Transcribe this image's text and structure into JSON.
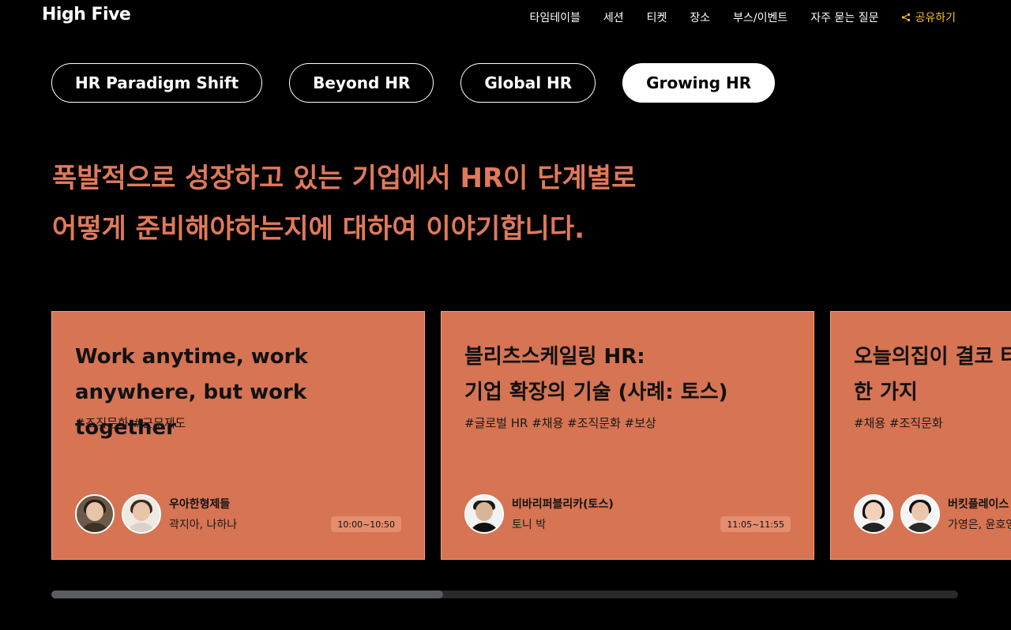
{
  "header": {
    "logo": "High Five",
    "nav": [
      {
        "label": "타임테이블"
      },
      {
        "label": "세션"
      },
      {
        "label": "티켓"
      },
      {
        "label": "장소"
      },
      {
        "label": "부스/이벤트"
      },
      {
        "label": "자주 묻는 질문"
      }
    ],
    "share_label": "공유하기",
    "share_icon": "share-icon"
  },
  "tabs": [
    {
      "label": "HR Paradigm Shift",
      "active": false
    },
    {
      "label": "Beyond HR",
      "active": false
    },
    {
      "label": "Global HR",
      "active": false
    },
    {
      "label": "Growing HR",
      "active": true
    }
  ],
  "headline": {
    "line1": "폭발적으로 성장하고 있는 기업에서 HR이 단계별로",
    "line2": "어떻게 준비해야하는지에 대하여 이야기합니다."
  },
  "cards": [
    {
      "title_line1": "Work anytime, work",
      "title_line2": "anywhere, but work together",
      "tags": "#조직문화 #근무제도",
      "org": "우아한형제들",
      "names": "곽지아, 나하나",
      "time": "10:00~10:50"
    },
    {
      "title_line1": "블리츠스케일링 HR:",
      "title_line2": "기업 확장의 기술 (사례: 토스)",
      "tags": "#글로벌 HR #채용 #조직문화 #보상",
      "org": "비바리퍼블리카(토스)",
      "names": "토니 박",
      "time": "11:05~11:55"
    },
    {
      "title_line1": "오늘의집이 결코 타",
      "title_line2": "한 가지",
      "tags": "#채용 #조직문화",
      "org": "버킷플레이스",
      "names": "가영은, 윤호영",
      "time": ""
    }
  ],
  "colors": {
    "accent": "#e07a5a",
    "card_bg": "#d67453",
    "share": "#f5c518"
  },
  "scrollbar": {
    "position_fraction": 0.43
  }
}
